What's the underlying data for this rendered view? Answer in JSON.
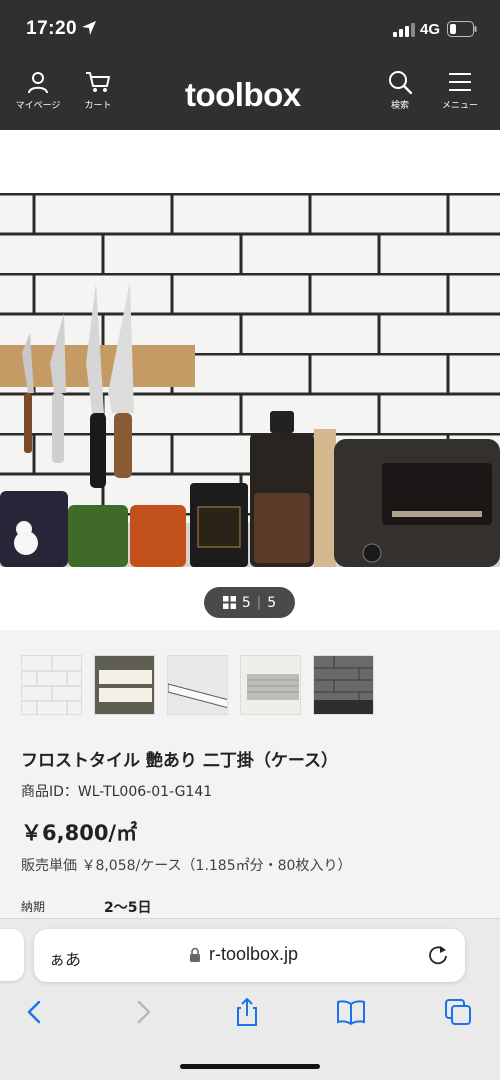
{
  "status_bar": {
    "time": "17:20",
    "network": "4G"
  },
  "header": {
    "logo": "toolbox",
    "mypage_label": "マイページ",
    "cart_label": "カート",
    "search_label": "検索",
    "menu_label": "メニュー"
  },
  "gallery": {
    "current": "5",
    "total": "5"
  },
  "product": {
    "title": "フロストタイル 艶あり 二丁掛（ケース）",
    "product_id": "商品ID：WL-TL006-01-G141",
    "price": "￥6,800/㎡",
    "unit_price": "販売単価 ￥8,058/ケース（1.185㎡分・80枚入り）",
    "delivery_label": "納期",
    "delivery_value": "2〜5日"
  },
  "browser": {
    "aa_label": "ぁあ",
    "url": "r-toolbox.jp"
  },
  "colors": {
    "header_bg": "#303030",
    "page_bg": "#ffffff",
    "section_bg": "#f3f3f3",
    "ios_blue": "#1a73e8"
  }
}
